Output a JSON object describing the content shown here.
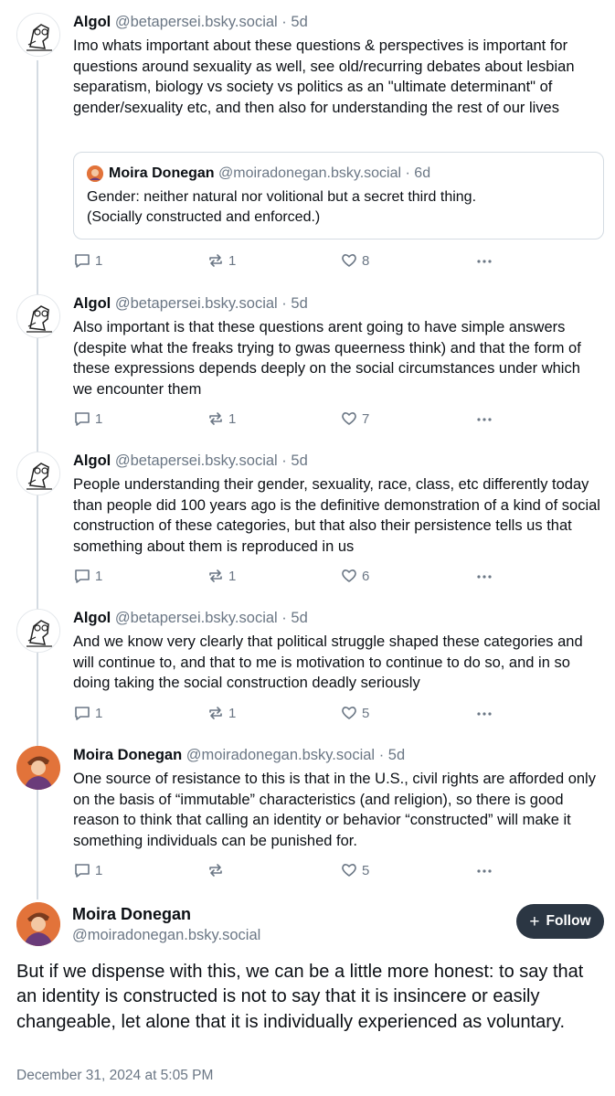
{
  "posts": [
    {
      "author": "Algol",
      "handle": "@betapersei.bsky.social",
      "separator": "·",
      "time": "5d",
      "text": "Imo whats important about these questions & perspectives is important for questions around sexuality as well, see old/recurring debates about lesbian separatism, biology vs society vs politics as an \"ultimate determinant\" of gender/sexuality etc, and then also for understanding the rest of our lives",
      "quote": {
        "author": "Moira Donegan",
        "handle": "@moiradonegan.bsky.social",
        "separator": "·",
        "time": "6d",
        "text_line1": "Gender: neither natural nor volitional but a secret third thing.",
        "text_line2": "(Socially constructed and enforced.)"
      },
      "replies": "1",
      "reposts": "1",
      "likes": "8"
    },
    {
      "author": "Algol",
      "handle": "@betapersei.bsky.social",
      "separator": "·",
      "time": "5d",
      "text": "Also important is that these questions arent going to have simple answers (despite what the freaks trying to gwas queerness think) and that the form of these expressions depends deeply on the social circumstances under which we encounter them",
      "replies": "1",
      "reposts": "1",
      "likes": "7"
    },
    {
      "author": "Algol",
      "handle": "@betapersei.bsky.social",
      "separator": "·",
      "time": "5d",
      "text": "People understanding their gender, sexuality, race, class, etc differently today than people did 100 years ago is the definitive demonstration of a kind of social construction of these categories, but that also their persistence tells us that something about them is reproduced in us",
      "replies": "1",
      "reposts": "1",
      "likes": "6"
    },
    {
      "author": "Algol",
      "handle": "@betapersei.bsky.social",
      "separator": "·",
      "time": "5d",
      "text": "And we know very clearly that political struggle shaped these categories and will continue to, and that to me is motivation to continue to do so, and in so doing taking the social construction deadly seriously",
      "replies": "1",
      "reposts": "1",
      "likes": "5"
    },
    {
      "author": "Moira Donegan",
      "handle": "@moiradonegan.bsky.social",
      "separator": "·",
      "time": "5d",
      "text": "One source of resistance to this is that in the U.S., civil rights are afforded only on the basis of “immutable” characteristics (and religion), so there is good reason to think that calling an identity or behavior “constructed” will make it something individuals can be punished for.",
      "replies": "1",
      "reposts": "",
      "likes": "5"
    }
  ],
  "main": {
    "author": "Moira Donegan",
    "handle": "@moiradonegan.bsky.social",
    "follow_plus": "+",
    "follow_label": "Follow",
    "text": "But if we dispense with this, we can be a little more honest: to say that an identity is constructed is not to say that it is insincere or easily changeable, let alone that it is individually experienced as voluntary.",
    "date": "December 31, 2024 at 5:05 PM"
  },
  "icons": {
    "reply": "reply-icon",
    "repost": "repost-icon",
    "like": "heart-icon",
    "more": "more-icon"
  },
  "colors": {
    "follow_button": "#2b3643",
    "muted_text": "#6b7785",
    "thread_line": "#d4dbe2",
    "moira_avatar": "#e2733a"
  }
}
